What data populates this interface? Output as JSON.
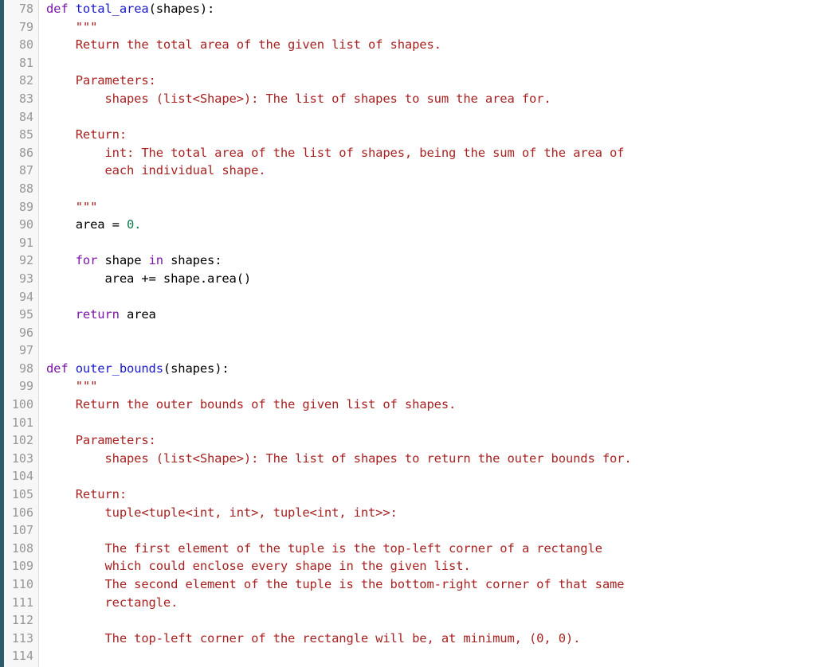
{
  "editor": {
    "language": "python",
    "first_line_number": 78,
    "last_line_number": 114,
    "colors": {
      "accent_bar": "#2d5a6b",
      "gutter_background": "#f7f7f7",
      "gutter_border": "#dcdcdc",
      "line_number": "#979797",
      "code_background": "#ffffff",
      "keyword": "#7b16a8",
      "function_name": "#1a1aca",
      "docstring": "#a82222",
      "number": "#0f7a4a",
      "plain": "#000000"
    }
  },
  "lines": [
    {
      "n": "78",
      "tokens": [
        {
          "t": "def ",
          "c": "kw"
        },
        {
          "t": "total_area",
          "c": "fn"
        },
        {
          "t": "(shapes):",
          "c": "pl"
        }
      ]
    },
    {
      "n": "79",
      "tokens": [
        {
          "t": "    \"\"\"",
          "c": "doc"
        }
      ]
    },
    {
      "n": "80",
      "tokens": [
        {
          "t": "    Return the total area of the given list of shapes.",
          "c": "doc"
        }
      ]
    },
    {
      "n": "81",
      "tokens": [
        {
          "t": "",
          "c": "pl"
        }
      ]
    },
    {
      "n": "82",
      "tokens": [
        {
          "t": "    Parameters:",
          "c": "doc"
        }
      ]
    },
    {
      "n": "83",
      "tokens": [
        {
          "t": "        shapes (list<Shape>): The list of shapes to sum the area for.",
          "c": "doc"
        }
      ]
    },
    {
      "n": "84",
      "tokens": [
        {
          "t": "",
          "c": "pl"
        }
      ]
    },
    {
      "n": "85",
      "tokens": [
        {
          "t": "    Return:",
          "c": "doc"
        }
      ]
    },
    {
      "n": "86",
      "tokens": [
        {
          "t": "        int: The total area of the list of shapes, being the sum of the area of",
          "c": "doc"
        }
      ]
    },
    {
      "n": "87",
      "tokens": [
        {
          "t": "        each individual shape.",
          "c": "doc"
        }
      ]
    },
    {
      "n": "88",
      "tokens": [
        {
          "t": "",
          "c": "pl"
        }
      ]
    },
    {
      "n": "89",
      "tokens": [
        {
          "t": "    \"\"\"",
          "c": "doc"
        }
      ]
    },
    {
      "n": "90",
      "tokens": [
        {
          "t": "    area = ",
          "c": "pl"
        },
        {
          "t": "0.",
          "c": "num"
        }
      ]
    },
    {
      "n": "91",
      "tokens": [
        {
          "t": "",
          "c": "pl"
        }
      ]
    },
    {
      "n": "92",
      "tokens": [
        {
          "t": "    ",
          "c": "pl"
        },
        {
          "t": "for",
          "c": "kw"
        },
        {
          "t": " shape ",
          "c": "pl"
        },
        {
          "t": "in",
          "c": "kw"
        },
        {
          "t": " shapes:",
          "c": "pl"
        }
      ]
    },
    {
      "n": "93",
      "tokens": [
        {
          "t": "        area += shape.area()",
          "c": "pl"
        }
      ]
    },
    {
      "n": "94",
      "tokens": [
        {
          "t": "",
          "c": "pl"
        }
      ]
    },
    {
      "n": "95",
      "tokens": [
        {
          "t": "    ",
          "c": "pl"
        },
        {
          "t": "return",
          "c": "kw"
        },
        {
          "t": " area",
          "c": "pl"
        }
      ]
    },
    {
      "n": "96",
      "tokens": [
        {
          "t": "",
          "c": "pl"
        }
      ]
    },
    {
      "n": "97",
      "tokens": [
        {
          "t": "",
          "c": "pl"
        }
      ]
    },
    {
      "n": "98",
      "tokens": [
        {
          "t": "def ",
          "c": "kw"
        },
        {
          "t": "outer_bounds",
          "c": "fn"
        },
        {
          "t": "(shapes):",
          "c": "pl"
        }
      ]
    },
    {
      "n": "99",
      "tokens": [
        {
          "t": "    \"\"\"",
          "c": "doc"
        }
      ]
    },
    {
      "n": "100",
      "tokens": [
        {
          "t": "    Return the outer bounds of the given list of shapes.",
          "c": "doc"
        }
      ]
    },
    {
      "n": "101",
      "tokens": [
        {
          "t": "",
          "c": "pl"
        }
      ]
    },
    {
      "n": "102",
      "tokens": [
        {
          "t": "    Parameters:",
          "c": "doc"
        }
      ]
    },
    {
      "n": "103",
      "tokens": [
        {
          "t": "        shapes (list<Shape>): The list of shapes to return the outer bounds for.",
          "c": "doc"
        }
      ]
    },
    {
      "n": "104",
      "tokens": [
        {
          "t": "",
          "c": "pl"
        }
      ]
    },
    {
      "n": "105",
      "tokens": [
        {
          "t": "    Return:",
          "c": "doc"
        }
      ]
    },
    {
      "n": "106",
      "tokens": [
        {
          "t": "        tuple<tuple<int, int>, tuple<int, int>>:",
          "c": "doc"
        }
      ]
    },
    {
      "n": "107",
      "tokens": [
        {
          "t": "",
          "c": "pl"
        }
      ]
    },
    {
      "n": "108",
      "tokens": [
        {
          "t": "        The first element of the tuple is the top-left corner of a rectangle",
          "c": "doc"
        }
      ]
    },
    {
      "n": "109",
      "tokens": [
        {
          "t": "        which could enclose every shape in the given list.",
          "c": "doc"
        }
      ]
    },
    {
      "n": "110",
      "tokens": [
        {
          "t": "        The second element of the tuple is the bottom-right corner of that same",
          "c": "doc"
        }
      ]
    },
    {
      "n": "111",
      "tokens": [
        {
          "t": "        rectangle.",
          "c": "doc"
        }
      ]
    },
    {
      "n": "112",
      "tokens": [
        {
          "t": "",
          "c": "pl"
        }
      ]
    },
    {
      "n": "113",
      "tokens": [
        {
          "t": "        The top-left corner of the rectangle will be, at minimum, (0, 0).",
          "c": "doc"
        }
      ]
    },
    {
      "n": "114",
      "tokens": [
        {
          "t": "",
          "c": "pl"
        }
      ]
    }
  ]
}
